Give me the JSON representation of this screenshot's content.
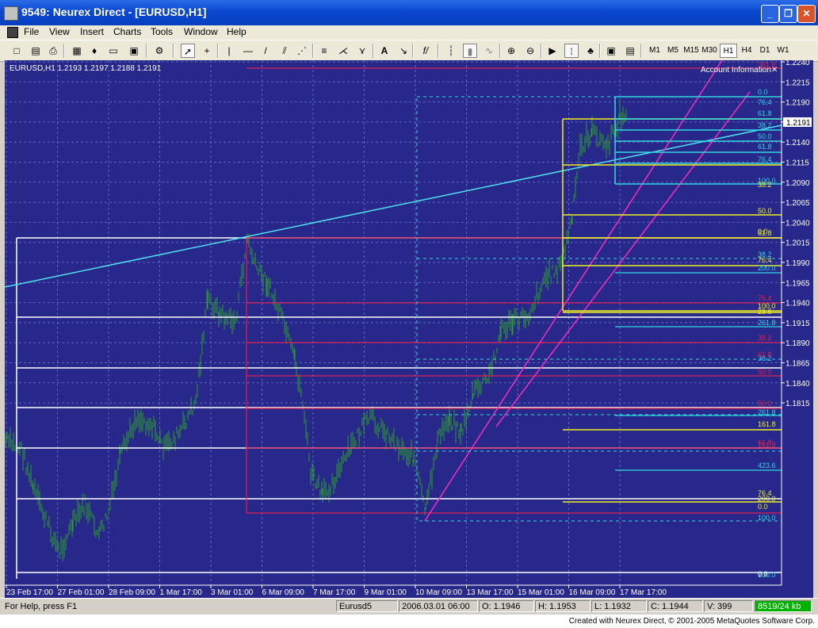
{
  "window": {
    "title": "9549: Neurex Direct - [EURUSD,H1]"
  },
  "menu": [
    "File",
    "View",
    "Insert",
    "Charts",
    "Tools",
    "Window",
    "Help"
  ],
  "toolbar": {
    "text_tool": "A",
    "fib_tool": "f/"
  },
  "timeframes": [
    "M1",
    "M5",
    "M15",
    "M30",
    "H1",
    "H4",
    "D1",
    "W1"
  ],
  "active_timeframe": "H1",
  "chart": {
    "header": "EURUSD,H1  1.2193 1.2197 1.2188 1.2191",
    "panel_label": "Account Information",
    "current_price": "1.2191",
    "price_axis": [
      "1.2240",
      "1.2215",
      "1.2190",
      "1.2165",
      "1.2140",
      "1.2115",
      "1.2090",
      "1.2065",
      "1.2040",
      "1.2015",
      "1.1990",
      "1.1965",
      "1.1940",
      "1.1915",
      "1.1890",
      "1.1865",
      "1.1840",
      "1.1815"
    ],
    "time_axis": [
      "23 Feb 17:00",
      "27 Feb 01:00",
      "28 Feb 09:00",
      "1 Mar 17:00",
      "3 Mar 01:00",
      "6 Mar 09:00",
      "7 Mar 17:00",
      "9 Mar 01:00",
      "10 Mar 09:00",
      "13 Mar 17:00",
      "15 Mar 01:00",
      "16 Mar 09:00",
      "17 Mar 17:00"
    ],
    "colors": {
      "background": "#27288a",
      "grid": "#5e64c0",
      "bars": "#2e9c2e",
      "fib_red": "#e01e50",
      "fib_yellow": "#f0f020",
      "fib_cyan": "#30d8e0",
      "fib_white": "#ffffff",
      "trend_magenta": "#f030c0",
      "trend_cyan": "#50e0f0"
    },
    "fib_labels_cyan_top": [
      "0.0",
      "76.4",
      "61.8",
      "38.2",
      "50.0",
      "61.8",
      "76.4",
      "100.0"
    ],
    "fib_labels_yellow": [
      "38.2",
      "50.0",
      "0.0",
      "61.8",
      "76.4",
      "100.0",
      "23.6",
      "161.8",
      "76.4",
      "200.0",
      "0.0"
    ],
    "fib_labels_cyan_mid": [
      "38.2",
      "200.0",
      "261.8",
      "38.2",
      "261.8",
      "423.6",
      "100.0",
      "100.0"
    ],
    "fib_labels_red": [
      "261.8",
      "76.4",
      "38.2",
      "61.8",
      "50.0",
      "50.0",
      "161.8",
      "61.8"
    ],
    "fib_labels_white": [
      "0.0"
    ]
  },
  "statusbar": {
    "help": "For Help, press F1",
    "profile": "Eurusd5",
    "datetime": "2006.03.01 06:00",
    "open": "O: 1.1946",
    "high": "H: 1.1953",
    "low": "L: 1.1932",
    "close": "C: 1.1944",
    "volume": "V: 399",
    "traffic": "8519/24 kb"
  },
  "credit": "Created with Neurex Direct, © 2001-2005 MetaQuotes Software Corp."
}
